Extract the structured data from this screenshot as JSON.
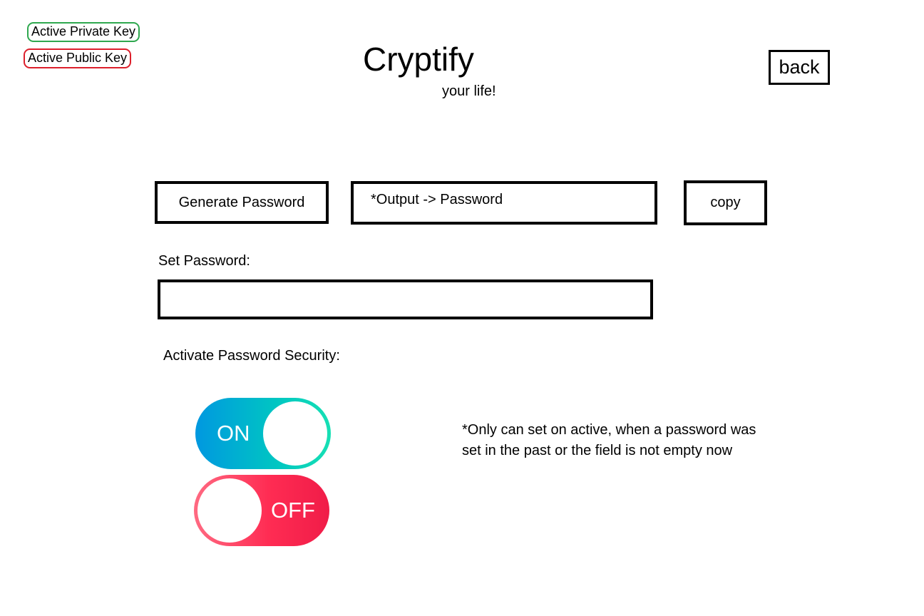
{
  "keys": {
    "private_label": "Active Private Key",
    "private_color": "#2fa84f",
    "public_label": "Active Public Key",
    "public_color": "#dc1f2b"
  },
  "header": {
    "title": "Cryptify",
    "subtitle": "your life!",
    "back_label": "back"
  },
  "generator": {
    "generate_label": "Generate Password",
    "output_text": "*Output -> Password",
    "copy_label": "copy"
  },
  "set_password": {
    "label": "Set Password:",
    "value": ""
  },
  "security": {
    "label": "Activate Password Security:",
    "toggle_on_label": "ON",
    "toggle_off_label": "OFF",
    "on_colors": [
      "#0098e0",
      "#17e0b4"
    ],
    "off_colors": [
      "#ff6a82",
      "#f01c48"
    ],
    "note_line1": "*Only can set on active, when a password was",
    "note_line2": "set in the past or the field is not empty now"
  }
}
